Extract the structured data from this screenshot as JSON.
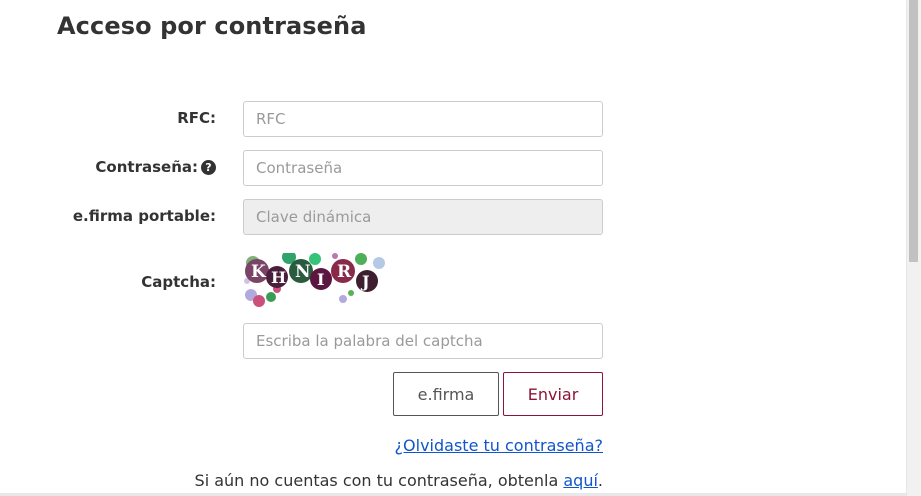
{
  "page": {
    "title": "Acceso por contraseña"
  },
  "form": {
    "rfc": {
      "label": "RFC:",
      "placeholder": "RFC",
      "value": ""
    },
    "password": {
      "label": "Contraseña:",
      "placeholder": "Contraseña",
      "value": "",
      "help_icon": "question-circle-icon"
    },
    "efirma_portable": {
      "label": "e.firma portable:",
      "placeholder": "Clave dinámica",
      "value": "",
      "disabled": true
    },
    "captcha": {
      "label": "Captcha:",
      "image_text": "KHNIRJ",
      "input_placeholder": "Escriba la palabra del captcha",
      "input_value": ""
    },
    "buttons": {
      "efirma_label": "e.firma",
      "submit_label": "Enviar"
    },
    "links": {
      "forgot_password": "¿Olvidaste tu contraseña?",
      "signup_prefix": "Si aún no cuentas con tu contraseña, obtenla ",
      "signup_link": "aquí",
      "signup_suffix": "."
    }
  },
  "colors": {
    "accent": "#8a1538",
    "link": "#1155cc",
    "text": "#333333",
    "disabled_bg": "#eeeeee"
  }
}
